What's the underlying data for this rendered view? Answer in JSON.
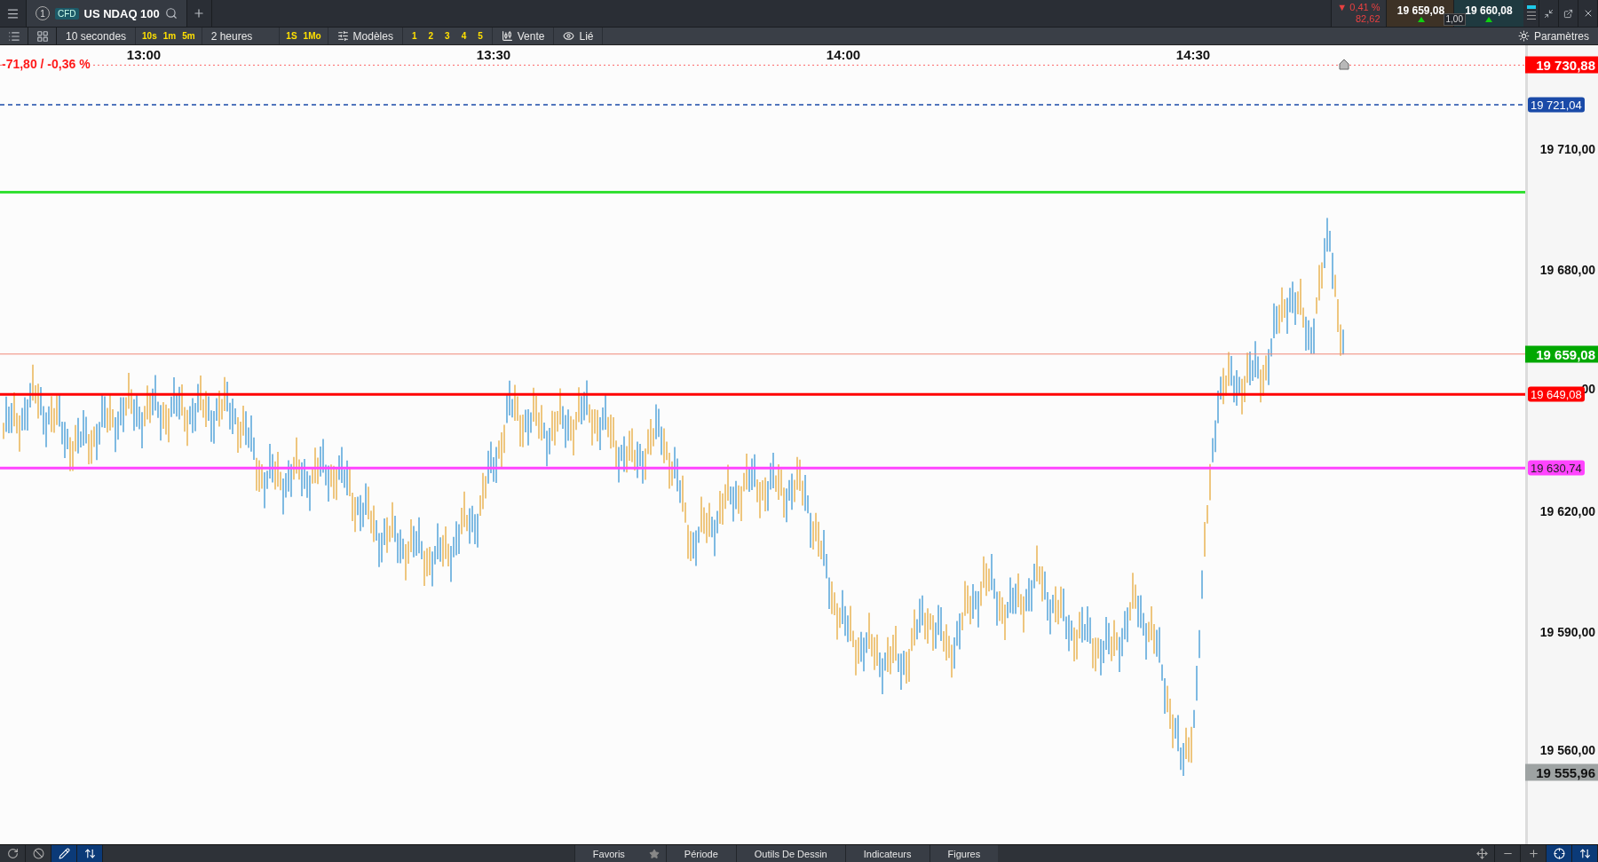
{
  "header": {
    "tab_number": "1",
    "badge": "CFD",
    "instrument": "US NDAQ 100",
    "change_percent": "▼ 0,41 %",
    "change_points": "82,62",
    "sell_price": "19 659,08",
    "spread": "1,00",
    "buy_price": "19 660,08"
  },
  "toolbar": {
    "interval": "10 secondes",
    "interval_shortcuts": [
      "10s",
      "1m",
      "5m"
    ],
    "range": "2 heures",
    "range_shortcuts": [
      "1S",
      "1Mo"
    ],
    "templates": "Modèles",
    "template_slots": [
      "1",
      "2",
      "3",
      "4",
      "5"
    ],
    "mode": "Vente",
    "link": "Lié",
    "settings": "Paramètres"
  },
  "chart": {
    "change_label": "-71,80 / -0,36 %",
    "time_labels": [
      "13:00",
      "13:30",
      "14:00",
      "14:30"
    ],
    "price_labels": [
      "19 710,00",
      "19 680,00",
      "00",
      "19 620,00",
      "19 590,00",
      "19 560,00"
    ],
    "levels": [
      {
        "kind": "high",
        "label": "19 730,88",
        "color": "#ff0000"
      },
      {
        "kind": "order",
        "label": "19 721,04",
        "color": "#1a4aa8"
      },
      {
        "kind": "current",
        "label": "19 659,08",
        "color": "#00a800"
      },
      {
        "kind": "line",
        "label": "19 649,08",
        "color": "#ff0000"
      },
      {
        "kind": "line",
        "label": "19 630,74",
        "color": "#ff44ff"
      },
      {
        "kind": "low",
        "label": "19 555,96",
        "color": "#9ea3a3"
      }
    ]
  },
  "footer": {
    "left_tools": [
      {
        "selected": false
      },
      {
        "selected": false
      },
      {
        "selected": true
      },
      {
        "selected": true
      }
    ],
    "tabs": [
      "Favoris",
      "Période",
      "Outils De Dessin",
      "Indicateurs",
      "Figures"
    ],
    "right_tools": [
      {
        "selected": false
      },
      {
        "selected": false
      },
      {
        "selected": false
      },
      {
        "selected": true
      },
      {
        "selected": true
      }
    ]
  }
}
